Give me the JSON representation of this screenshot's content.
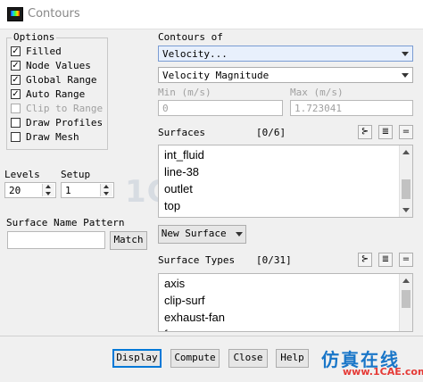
{
  "window": {
    "title": "Contours"
  },
  "options": {
    "legend": "Options",
    "items": [
      {
        "label": "Filled",
        "checked": true,
        "enabled": true
      },
      {
        "label": "Node Values",
        "checked": true,
        "enabled": true
      },
      {
        "label": "Global Range",
        "checked": true,
        "enabled": true
      },
      {
        "label": "Auto Range",
        "checked": true,
        "enabled": true
      },
      {
        "label": "Clip to Range",
        "checked": false,
        "enabled": false
      },
      {
        "label": "Draw Profiles",
        "checked": false,
        "enabled": true
      },
      {
        "label": "Draw Mesh",
        "checked": false,
        "enabled": true
      }
    ]
  },
  "levels": {
    "label": "Levels",
    "value": "20"
  },
  "setup": {
    "label": "Setup",
    "value": "1"
  },
  "pattern": {
    "label": "Surface Name Pattern",
    "value": "",
    "match_label": "Match"
  },
  "contours_of": {
    "label": "Contours of",
    "variable": "Velocity...",
    "subvariable": "Velocity Magnitude"
  },
  "range": {
    "min_label": "Min (m/s)",
    "min_value": "0",
    "max_label": "Max (m/s)",
    "max_value": "1.723041"
  },
  "surfaces": {
    "label": "Surfaces",
    "count": "[0/6]",
    "items": [
      "int_fluid",
      "line-38",
      "outlet",
      "top"
    ]
  },
  "new_surface": {
    "label": "New Surface"
  },
  "surface_types": {
    "label": "Surface Types",
    "count": "[0/31]",
    "items": [
      "axis",
      "clip-surf",
      "exhaust-fan",
      "f"
    ]
  },
  "toolbar_icons": {
    "select_all": "select-all-icon",
    "list": "list-icon",
    "deselect": "deselect-icon"
  },
  "buttons": {
    "display": "Display",
    "compute": "Compute",
    "close": "Close",
    "help": "Help"
  },
  "watermark": "1CAE.COM",
  "brand": {
    "chinese": "仿真在线",
    "url": "www.1CAE.com"
  },
  "colors": {
    "accent": "#0078d7",
    "brand_blue": "#1976c8",
    "brand_red": "#e53935"
  }
}
